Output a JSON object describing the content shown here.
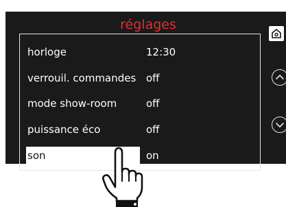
{
  "screen": {
    "title": "réglages"
  },
  "menu": {
    "items": [
      {
        "label": "horloge",
        "value": "12:30"
      },
      {
        "label": "verrouil. commandes",
        "value": "off"
      },
      {
        "label": "mode show-room",
        "value": "off"
      },
      {
        "label": "puissance éco",
        "value": "off"
      },
      {
        "label": "son",
        "value": "on"
      }
    ],
    "selected_index": 4
  },
  "icons": {
    "home": "home-icon",
    "up": "chevron-up-icon",
    "down": "chevron-down-icon",
    "pointer": "pointing-hand-icon"
  },
  "colors": {
    "title": "#e03030",
    "screen_bg": "#1a1a1a",
    "highlight": "#ffffff"
  }
}
